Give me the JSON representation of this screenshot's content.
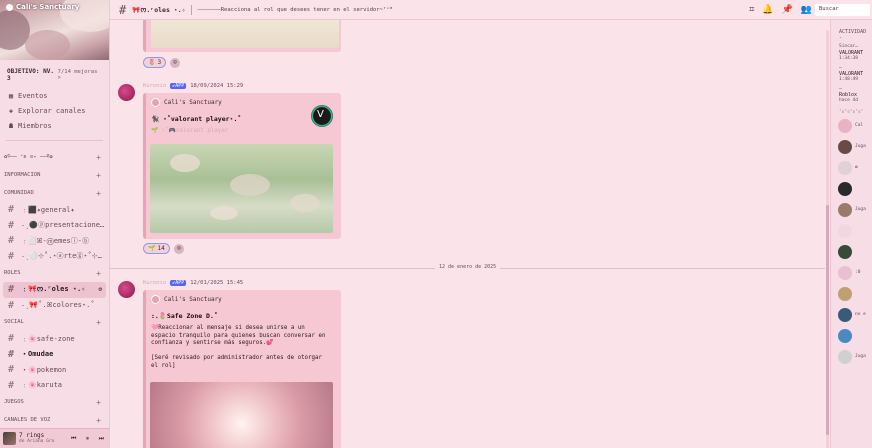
{
  "server": {
    "name": "Cali's Sanctuary",
    "boost_level": "OBJETIVO: NV. 3",
    "boost_more": "7/14 mejoras >",
    "menu": [
      {
        "icon": "calendar-icon",
        "glyph": "▦",
        "label": "Eventos"
      },
      {
        "icon": "compass-icon",
        "glyph": "◈",
        "label": "Explorar canales"
      },
      {
        "icon": "members-icon",
        "glyph": "☗",
        "label": "Miembros"
      }
    ]
  },
  "sidebar": {
    "categories": [
      {
        "label": "✿୨── ⁺ʚ ɞ˖ ──୧✿",
        "channels": []
      },
      {
        "label": "INFORMACION",
        "channels": []
      },
      {
        "label": "COMUNIDAD",
        "channels": [
          {
            "label": "﹕⬛✦general✦",
            "state": "normal"
          },
          {
            "label": "˗ˏ⚫ⓟpresentacione…",
            "state": "normal"
          },
          {
            "label": "﹕⬜ꕤ-ⓜemesⓘ-ⓑ",
            "state": "normal"
          },
          {
            "label": "˗ˏ⚪⊹˚.⋆ⓐrteⓖ⋆˚⊹…",
            "state": "normal"
          }
        ]
      },
      {
        "label": "ROLES",
        "channels": [
          {
            "label": "﹕🎀ᰔ.ʳoles ⋆.✧",
            "state": "active"
          },
          {
            "label": "˗ˏ🎀˚.ꕤcolores⋆.˚",
            "state": "normal"
          }
        ]
      },
      {
        "label": "SOCIAL",
        "channels": [
          {
            "label": "﹕🌸safe-zone",
            "state": "normal"
          },
          {
            "label": "・Omudae",
            "state": "bold"
          },
          {
            "label": "・🌸pokemon",
            "state": "normal"
          },
          {
            "label": "﹕🌸karuta",
            "state": "normal"
          }
        ]
      },
      {
        "label": "JUEGOS",
        "channels": []
      },
      {
        "label": "CANALES DE VOZ",
        "channels": []
      }
    ]
  },
  "player": {
    "title": "7 rings",
    "artist": "de Ariana Gra",
    "controls": "⏮ ⏸ ⏭"
  },
  "topbar": {
    "channel_name": "🎀ᰔ.ʳoles ⋆.✧",
    "topic": "———————Reacciona al rol que desees tener en el servidor~ᵀˢᴮ",
    "search_placeholder": "Buscar",
    "icons": [
      "threads-icon",
      "bell-icon",
      "pin-icon",
      "members-icon"
    ]
  },
  "messages": [
    {
      "user": "Kuronio",
      "app_badge": "✔APP",
      "time": "18/09/2024 15:29",
      "author": "Cali's Sanctuary",
      "title": "🐈‍⬛ ⋆˚valorant player⋆.˚",
      "subtitle": "🌱 ⋆˚🎮valorant player",
      "reaction_emoji": "🌱",
      "reaction_count": "14"
    },
    {
      "user": "Kuronio",
      "app_badge": "✔APP",
      "time": "12/01/2025 15:45",
      "author": "Cali's Sanctuary",
      "title": ":.🌷Safe Zone D.˚",
      "body_lines": [
        "🩷Reaccionar al mensaje si desea unirse a un",
        "espacio tranquilo para quienes buscan conversar en",
        "confianza y sentirse más seguros.💕",
        "",
        "[Seré revisado por administrador antes de otorgar",
        "el rol]"
      ]
    }
  ],
  "top_reaction": {
    "emoji": "🌷",
    "count": "3"
  },
  "date_divider": "12 de enero de 2025",
  "members": {
    "activity_header": "ACTIVIDAD -",
    "activities": [
      {
        "name": "Siocar…",
        "game": "VALORANT",
        "time": "1:34:38"
      },
      {
        "name": "…",
        "game": "VALORANT",
        "time": "1:48:49"
      },
      {
        "name": "…",
        "game": "Roblox",
        "time": "hace 4d"
      }
    ],
    "group_label": "˚ʚ˚ɞ˚ʚ˚ɞ˚",
    "list": [
      {
        "color": "#e8b4c4",
        "text": "Cal"
      },
      {
        "color": "#6a4a48",
        "text": "Juga"
      },
      {
        "color": "#e0d0d8",
        "text": "✿"
      },
      {
        "color": "#2a2a2a",
        "text": ""
      },
      {
        "color": "#9a7a6a",
        "text": "Juga"
      },
      {
        "color": "#f0d8e0",
        "text": ""
      },
      {
        "color": "#3a4a3a",
        "text": ""
      },
      {
        "color": "#e8c0d0",
        "text": ":0"
      },
      {
        "color": "#c0a070",
        "text": ""
      },
      {
        "color": "#3a5a7a",
        "text": "no e"
      },
      {
        "color": "#4a8ac0",
        "text": ""
      },
      {
        "color": "#d0d0d0",
        "text": "Juga"
      }
    ]
  }
}
